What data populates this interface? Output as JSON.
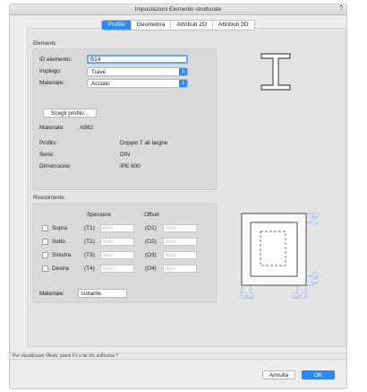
{
  "window": {
    "title": "Impostazioni Elemento strutturale",
    "help_glyph": "?"
  },
  "tabs": [
    {
      "label": "Profilo",
      "active": true
    },
    {
      "label": "Geometria",
      "active": false
    },
    {
      "label": "Attributi 2D",
      "active": false
    },
    {
      "label": "Attributi 3D",
      "active": false
    }
  ],
  "elemento": {
    "group_label": "Elemento",
    "id_label": "ID elemento:",
    "id_value": "B14",
    "impiego_label": "Impiego:",
    "impiego_value": "Trave",
    "materiale_label": "Materiale:",
    "materiale_value": "Acciaio",
    "scegli_button": "Scegli profilo...",
    "info": [
      {
        "label": "Materiale:",
        "value": "A992"
      },
      {
        "label": "Profilo:",
        "value": "Doppio T ali larghe"
      },
      {
        "label": "Serie:",
        "value": "DIN"
      },
      {
        "label": "Dimensione:",
        "value": "IPE 600"
      }
    ]
  },
  "rivestimento": {
    "group_label": "Rivestimento",
    "col_spessore": "Spessore",
    "col_offset": "Offset",
    "rows": [
      {
        "label": "Sopra",
        "t_code": "(T1)",
        "t_value": "0cm",
        "o_code": "(O1)",
        "o_value": "0cm"
      },
      {
        "label": "Sotto",
        "t_code": "(T2)",
        "t_value": "0cm",
        "o_code": "(O2)",
        "o_value": "0cm"
      },
      {
        "label": "Sinistra",
        "t_code": "(T3)",
        "t_value": "0cm",
        "o_code": "(O3)",
        "o_value": "0cm"
      },
      {
        "label": "Destra",
        "t_code": "(T4)",
        "t_value": "0cm",
        "o_code": "(O4)",
        "o_value": "0cm"
      }
    ],
    "materiale_label": "Materiale:",
    "materiale_value": "isolante"
  },
  "diagram_labels": {
    "right": [
      "O1",
      "T1",
      "T2",
      "O2"
    ],
    "bottom": [
      "T3",
      "O3",
      "O4",
      "T4"
    ]
  },
  "status_text": "Per visualizzare l'Aiuto, premi F1 o fai clic sull'icona ?",
  "buttons": {
    "cancel": "Annulla",
    "ok": "OK"
  },
  "colors": {
    "accent": "#2b8af7"
  }
}
